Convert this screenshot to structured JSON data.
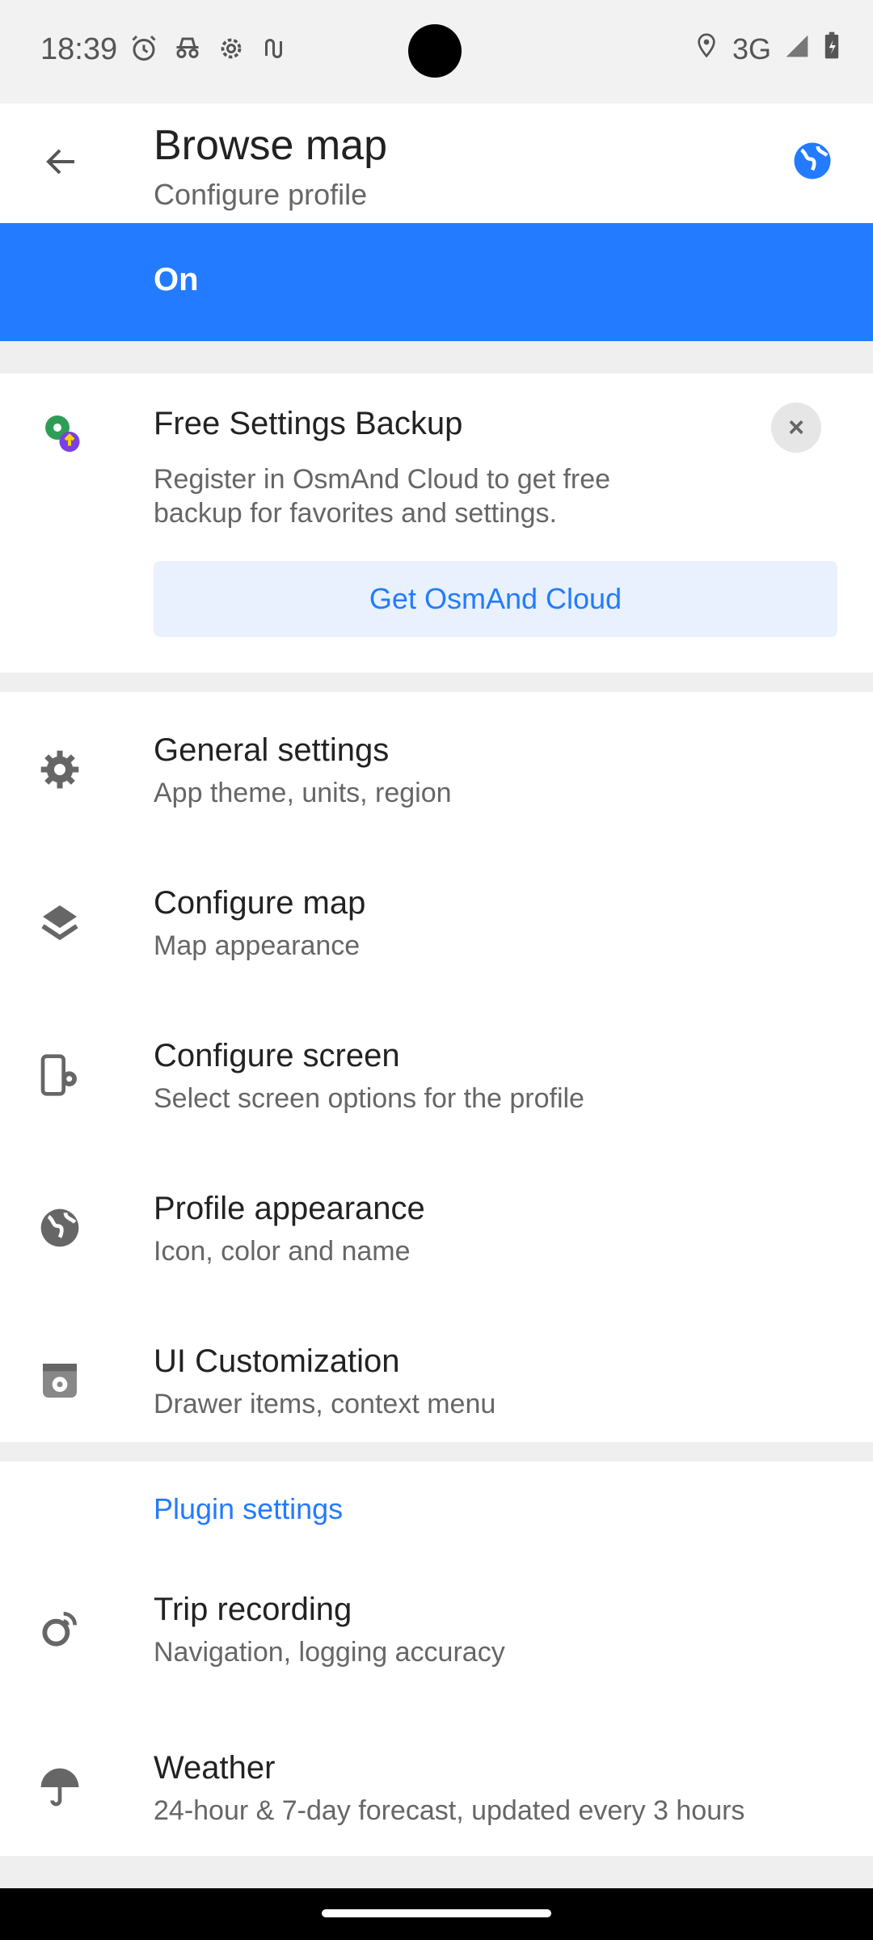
{
  "status_bar": {
    "time": "18:39",
    "left_icons": [
      "alarm-icon",
      "incognito-icon",
      "settings-gear-icon",
      "tasks-icon"
    ],
    "network": "3G",
    "right_icons": [
      "location-icon",
      "signal-icon",
      "battery-charging-icon"
    ]
  },
  "app_bar": {
    "title": "Browse map",
    "subtitle": "Configure profile",
    "back_icon": "back-arrow-icon",
    "profile_icon": "globe-icon"
  },
  "toggle_bar": {
    "label": "On",
    "color": "#237bff"
  },
  "backup_card": {
    "title": "Free Settings Backup",
    "description": "Register in OsmAnd Cloud to get free backup for favorites and settings.",
    "button_label": "Get OsmAnd Cloud",
    "close_label": "×"
  },
  "settings": [
    {
      "title": "General settings",
      "desc": "App theme, units, region",
      "icon": "gear-icon"
    },
    {
      "title": "Configure map",
      "desc": "Map appearance",
      "icon": "layers-icon"
    },
    {
      "title": "Configure screen",
      "desc": "Select screen options for the profile",
      "icon": "screen-settings-icon"
    },
    {
      "title": "Profile appearance",
      "desc": "Icon, color and name",
      "icon": "globe-icon"
    },
    {
      "title": "UI Customization",
      "desc": "Drawer items, context menu",
      "icon": "ui-customization-icon"
    }
  ],
  "plugin_settings": {
    "header": "Plugin settings",
    "items": [
      {
        "title": "Trip recording",
        "desc": "Navigation, logging accuracy",
        "icon": "trip-recording-icon"
      },
      {
        "title": "Weather",
        "desc": "24-hour & 7-day forecast, updated every 3 hours",
        "icon": "umbrella-icon"
      }
    ]
  },
  "colors": {
    "accent": "#237bff",
    "icon_gray": "#666666"
  }
}
